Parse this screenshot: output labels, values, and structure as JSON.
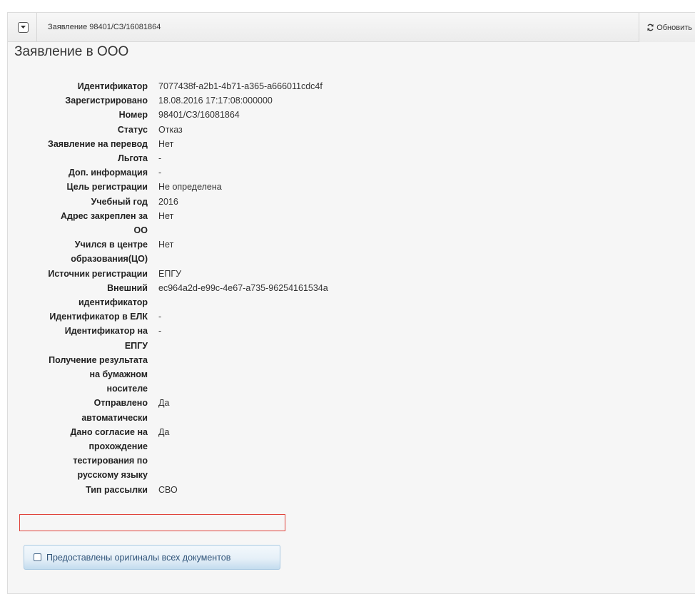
{
  "header": {
    "title": "Заявление 98401/СЗ/16081864",
    "refresh_label": "Обновить"
  },
  "section_title": "Заявление в ООО",
  "fields": [
    {
      "label": [
        "Идентификатор"
      ],
      "value": "7077438f-a2b1-4b71-a365-a666011cdc4f"
    },
    {
      "label": [
        "Зарегистрировано"
      ],
      "value": "18.08.2016 17:17:08:000000"
    },
    {
      "label": [
        "Номер"
      ],
      "value": "98401/СЗ/16081864"
    },
    {
      "label": [
        "Статус"
      ],
      "value": "Отказ"
    },
    {
      "label": [
        "Заявление на перевод"
      ],
      "value": "Нет"
    },
    {
      "label": [
        "Льгота"
      ],
      "value": "-"
    },
    {
      "label": [
        "Доп. информация"
      ],
      "value": "-"
    },
    {
      "label": [
        "Цель регистрации"
      ],
      "value": "Не определена"
    },
    {
      "label": [
        "Учебный год"
      ],
      "value": "2016"
    },
    {
      "label": [
        "Адрес закреплен за",
        "ОО"
      ],
      "value": "Нет"
    },
    {
      "label": [
        "Учился в центре",
        "образования(ЦО)"
      ],
      "value": "Нет"
    },
    {
      "label": [
        "Источник регистрации"
      ],
      "value": "ЕПГУ"
    },
    {
      "label": [
        "Внешний",
        "идентификатор"
      ],
      "value": "ec964a2d-e99c-4e67-a735-96254161534a"
    },
    {
      "label": [
        "Идентификатор в ЕЛК"
      ],
      "value": "-"
    },
    {
      "label": [
        "Идентификатор на",
        "ЕПГУ"
      ],
      "value": "-"
    },
    {
      "label": [
        "Получение результата",
        "на бумажном",
        "носителе"
      ],
      "value": ""
    },
    {
      "label": [
        "Отправлено",
        "автоматически"
      ],
      "value": "Да"
    },
    {
      "label": [
        "Дано согласие на",
        "прохождение",
        "тестирования по",
        "русскому языку"
      ],
      "value": "Да"
    },
    {
      "label": [
        "Тип рассылки"
      ],
      "value": "СВО"
    }
  ],
  "originals_button_label": "Предоставлены оригиналы всех документов",
  "colors": {
    "highlight_border": "#e0443c",
    "button_text": "#31557a"
  }
}
